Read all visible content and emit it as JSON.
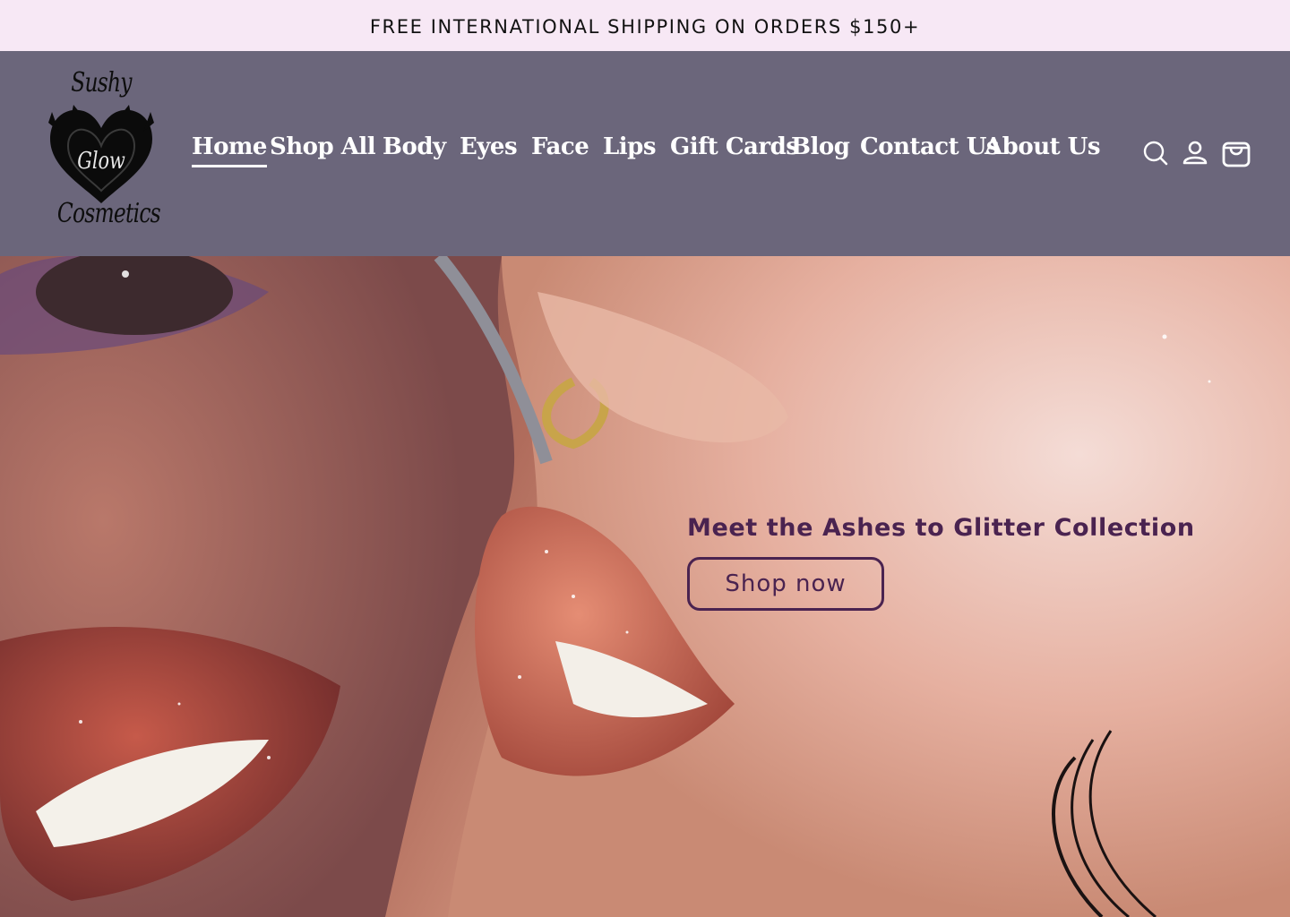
{
  "announcement": {
    "text": "FREE INTERNATIONAL SHIPPING ON ORDERS $150+"
  },
  "header": {
    "logo": {
      "line1": "Sushy",
      "line2": "Glow",
      "line3": "Cosmetics"
    },
    "nav": [
      {
        "label": "Home",
        "active": true
      },
      {
        "label": "Shop All"
      },
      {
        "label": "Body"
      },
      {
        "label": "Eyes"
      },
      {
        "label": "Face"
      },
      {
        "label": "Lips"
      },
      {
        "label": "Gift Cards"
      },
      {
        "label": "Blog"
      },
      {
        "label": "Contact Us"
      },
      {
        "label": "About Us"
      }
    ],
    "icons": [
      "search-icon",
      "account-icon",
      "cart-icon"
    ]
  },
  "hero": {
    "heading": "Meet the Ashes to Glitter Collection",
    "button_label": "Shop now"
  },
  "colors": {
    "announcement_bg": "#f7e8f5",
    "header_bg": "#6b667b",
    "accent": "#4a2350"
  }
}
